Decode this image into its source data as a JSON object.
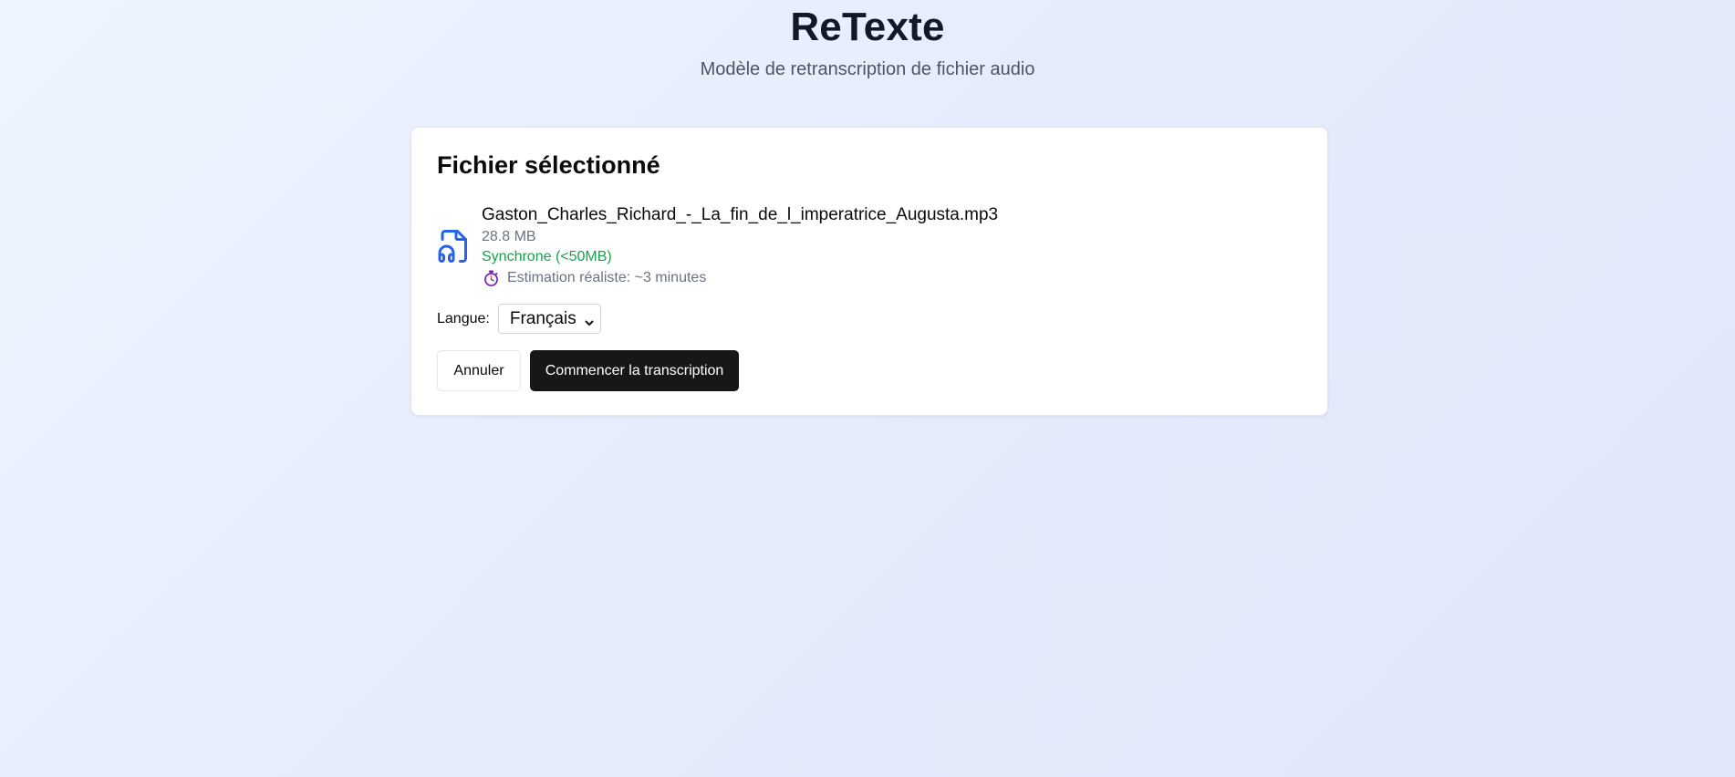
{
  "header": {
    "title": "ReTexte",
    "subtitle": "Modèle de retranscription de fichier audio"
  },
  "card": {
    "title": "Fichier sélectionné",
    "file": {
      "icon": "audio-file-icon",
      "name": "Gaston_Charles_Richard_-_La_fin_de_l_imperatrice_Augusta.mp3",
      "size": "28.8 MB",
      "mode": "Synchrone (<50MB)",
      "estimate_icon": "stopwatch-icon",
      "estimate": "Estimation réaliste: ~3 minutes"
    },
    "language": {
      "label": "Langue:",
      "selected": "Français"
    },
    "actions": {
      "cancel_label": "Annuler",
      "start_label": "Commencer la transcription"
    }
  },
  "colors": {
    "accent_icon": "#2563eb",
    "mode_green": "#16a34a",
    "primary_button": "#171717"
  }
}
